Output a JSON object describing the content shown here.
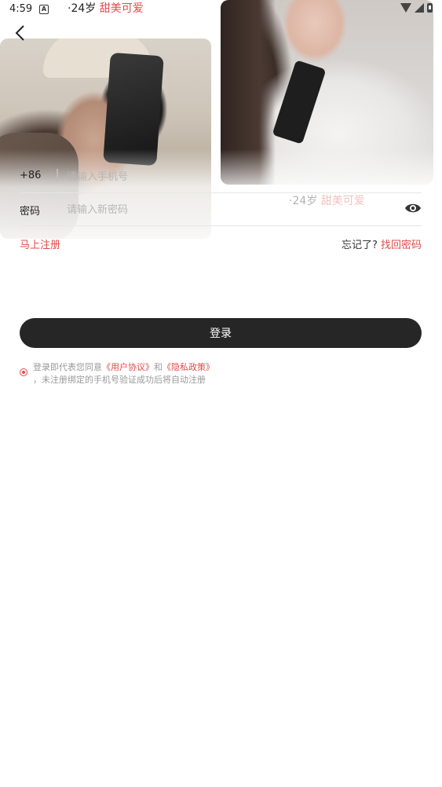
{
  "status_bar": {
    "time": "4:59",
    "left_icon": "A",
    "right_icons": [
      "wifi-icon",
      "signal-icon",
      "battery-icon"
    ]
  },
  "captions": [
    {
      "age": "·24岁",
      "tag": "甜美可爱"
    },
    {
      "age": "·24岁",
      "tag": "甜美可爱"
    }
  ],
  "form": {
    "phone": {
      "prefix": "+86",
      "placeholder": "请输入手机号",
      "value": ""
    },
    "password": {
      "label": "密码",
      "placeholder": "请输入新密码",
      "value": ""
    }
  },
  "links": {
    "register": "马上注册",
    "forgot_label": "忘记了?",
    "forgot_link": "找回密码"
  },
  "login_button": "登录",
  "agreement": {
    "prefix": "登录即代表您同意",
    "user_agreement": "《用户协议》",
    "and": "和",
    "privacy_policy": "《隐私政策》",
    "line2": "，未注册绑定的手机号验证成功后将自动注册",
    "checked": true
  },
  "colors": {
    "accent": "#e24a4a",
    "button": "#262626"
  }
}
